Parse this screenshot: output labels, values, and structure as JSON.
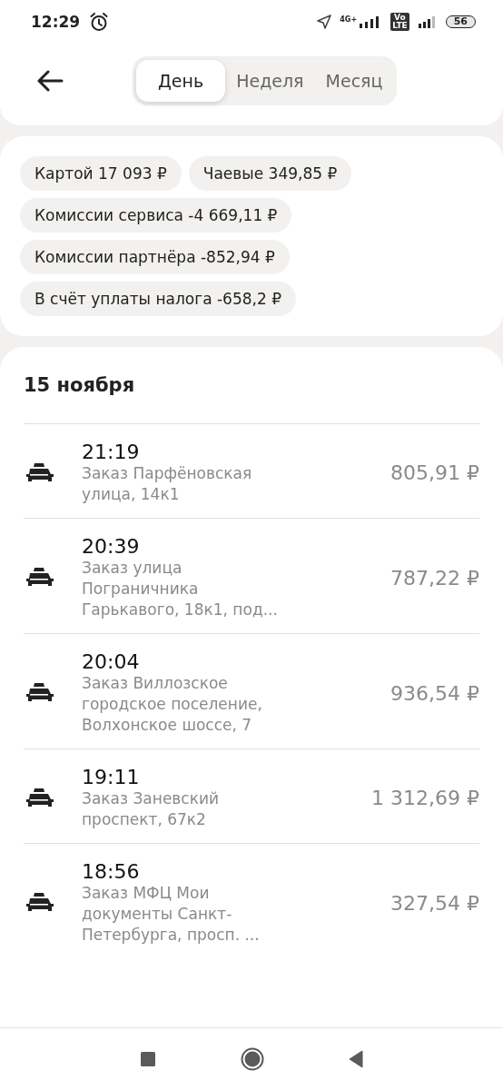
{
  "status_bar": {
    "time": "12:29",
    "network": "4G+",
    "volte_top": "Vo",
    "volte_bottom": "LTE",
    "battery": "56"
  },
  "tabs": [
    {
      "label": "День",
      "selected": true
    },
    {
      "label": "Неделя",
      "selected": false
    },
    {
      "label": "Месяц",
      "selected": false
    }
  ],
  "summary_chips": [
    [
      "Картой 17 093 ₽",
      "Чаевые 349,85 ₽"
    ],
    [
      "Комиссии сервиса -4 669,11 ₽"
    ],
    [
      "Комиссии партнёра -852,94 ₽"
    ],
    [
      "В счёт уплаты налога -658,2 ₽"
    ]
  ],
  "date_heading": "15 ноября",
  "orders": [
    {
      "time": "21:19",
      "description": "Заказ Парфёновская улица, 14к1",
      "amount": "805,91 ₽"
    },
    {
      "time": "20:39",
      "description": "Заказ улица Пограничника Гарькавого, 18к1, под...",
      "amount": "787,22 ₽"
    },
    {
      "time": "20:04",
      "description": "Заказ Виллозское городское поселение, Волхонское шоссе, 7",
      "amount": "936,54 ₽"
    },
    {
      "time": "19:11",
      "description": "Заказ Заневский проспект, 67к2",
      "amount": "1 312,69 ₽"
    },
    {
      "time": "18:56",
      "description": "Заказ МФЦ Мои документы Санкт-Петербурга, просп. ...",
      "amount": "327,54 ₽"
    }
  ]
}
